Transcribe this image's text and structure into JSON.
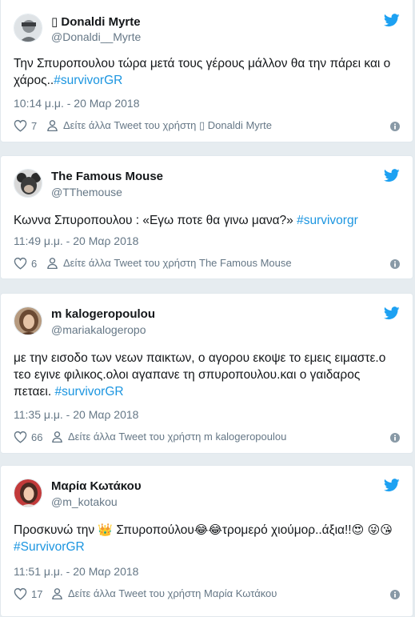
{
  "colors": {
    "accent": "#1da1f2",
    "link": "#1b95e0",
    "muted": "#657786",
    "background": "#e6ecf0"
  },
  "tweets": [
    {
      "name": "▯ Donaldi Myrte",
      "handle": "@Donaldi__Myrte",
      "text": "Την Σπυροπουλου τώρα μετά τους γέρους μάλλον θα την πάρει και ο χάρος..",
      "hashtag": "#survivorGR",
      "time": "10:14 μ.μ. - 20 Μαρ 2018",
      "likes": "7",
      "more_label": "Δείτε άλλα Tweet του χρήστη ▯ Donaldi Myrte"
    },
    {
      "name": "The Famous Mouse",
      "handle": "@TThemouse",
      "text": "Κωννα Σπυροπουλου : «Εγω ποτε θα γινω μανα?»",
      "hashtag": "#survivorgr",
      "time": "11:49 μ.μ. - 20 Μαρ 2018",
      "likes": "6",
      "more_label": "Δείτε άλλα Tweet του χρήστη The Famous Mouse"
    },
    {
      "name": "m kalogeropoulou",
      "handle": "@mariakalogeropo",
      "text": "με την εισοδο των νεων παικτων, ο αγορου εκοψε το εμεις ειμαστε.ο τεο εγινε φιλικος.ολοι αγαπανε τη σπυροπουλου.και ο γαιδαρος πεταει.",
      "hashtag": "#survivorGR",
      "time": "11:35 μ.μ. - 20 Μαρ 2018",
      "likes": "66",
      "more_label": "Δείτε άλλα Tweet του χρήστη m kalogeropoulou"
    },
    {
      "name": "Μαρία Κωτάκου",
      "handle": "@m_kotakou",
      "text_a": "Προσκυνώ την",
      "text_b": "Σπυροπούλου",
      "text_c": "τρομερό χιούμορ..άξια!!",
      "hashtag": "#SurvivorGR",
      "emoji_crown": "👑",
      "emoji_laugh": "😂😂",
      "emoji_love": "😍",
      "emoji_tongue": "😜😘",
      "time": "11:51 μ.μ. - 20 Μαρ 2018",
      "likes": "17",
      "more_label": "Δείτε άλλα Tweet του χρήστη Μαρία Κωτάκου"
    }
  ]
}
